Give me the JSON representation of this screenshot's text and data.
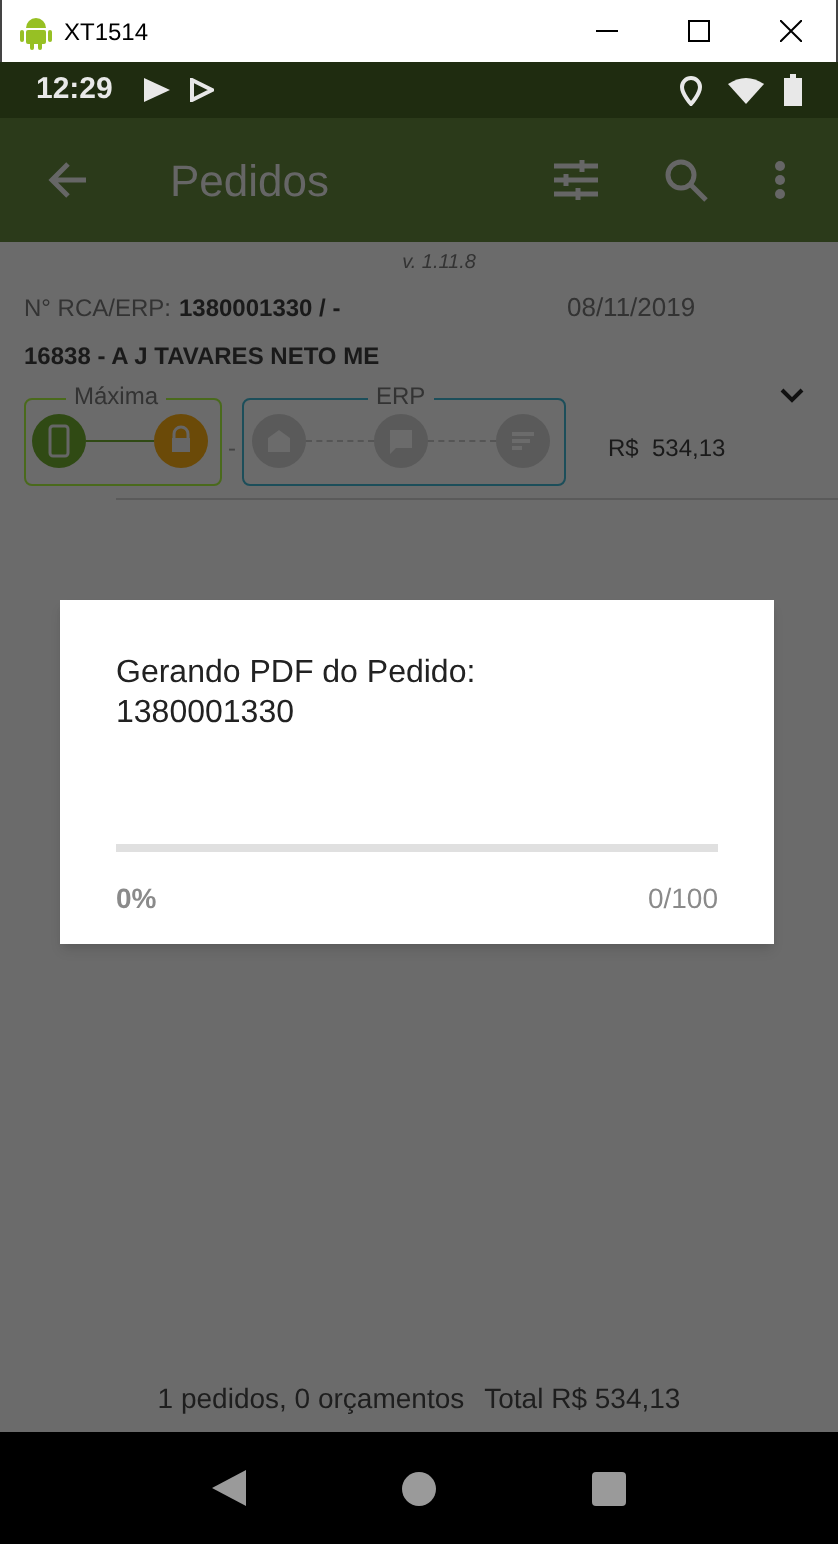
{
  "window": {
    "title": "XT1514"
  },
  "status_bar": {
    "time": "12:29"
  },
  "app_bar": {
    "title": "Pedidos"
  },
  "order": {
    "version": "v. 1.11.8",
    "rca_label": "N° RCA/ERP:",
    "rca_value": "1380001330 / -",
    "date": "08/11/2019",
    "customer": "16838 - A J TAVARES NETO ME",
    "maxima_label": "Máxima",
    "erp_label": "ERP",
    "separator": "-",
    "total": "R$  534,13"
  },
  "dialog": {
    "message": "Gerando PDF do Pedido: 1380001330",
    "progress": {
      "level": 0
    },
    "percent": "0%",
    "count": "0/100"
  },
  "footer": {
    "summary": "1 pedidos, 0 orçamentos",
    "total": "Total R$ 534,13"
  }
}
